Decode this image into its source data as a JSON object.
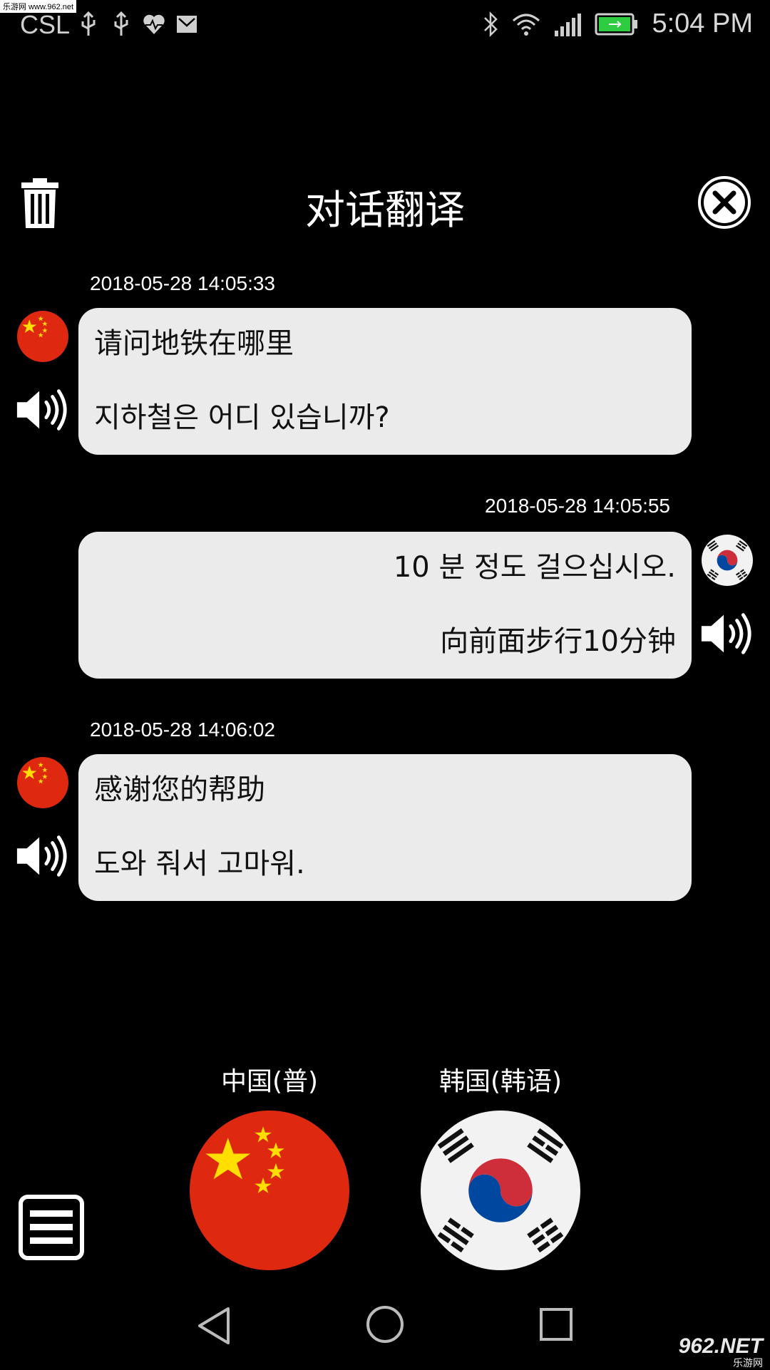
{
  "status_bar": {
    "carrier": "CSL",
    "time": "5:04 PM",
    "watermark": "乐游网 www.962.net"
  },
  "header": {
    "title": "对话翻译"
  },
  "messages": [
    {
      "timestamp": "2018-05-28 14:05:33",
      "side": "left",
      "flag": "china",
      "source": "请问地铁在哪里",
      "translation": "지하철은 어디 있습니까?"
    },
    {
      "timestamp": "2018-05-28 14:05:55",
      "side": "right",
      "flag": "korea",
      "source": "10 분 정도 걸으십시오.",
      "translation": "向前面步行10分钟"
    },
    {
      "timestamp": "2018-05-28 14:06:02",
      "side": "left",
      "flag": "china",
      "source": "感谢您的帮助",
      "translation": "도와 줘서 고마워."
    }
  ],
  "languages": {
    "left_label": "中国(普)",
    "right_label": "韩国(韩语)"
  },
  "icons": {
    "trash": "trash-icon",
    "close": "close-circle-icon",
    "speaker": "speaker-icon",
    "menu": "menu-icon",
    "back": "nav-back-icon",
    "home": "nav-home-icon",
    "recent": "nav-recent-icon"
  },
  "colors": {
    "background": "#000000",
    "bubble": "#ebebeb",
    "china_red": "#de2910",
    "china_star": "#ffde00",
    "korea_red": "#cd2e3a",
    "korea_blue": "#0047a0"
  },
  "watermark_logo": {
    "main": "962.NET",
    "sub": "乐游网"
  }
}
